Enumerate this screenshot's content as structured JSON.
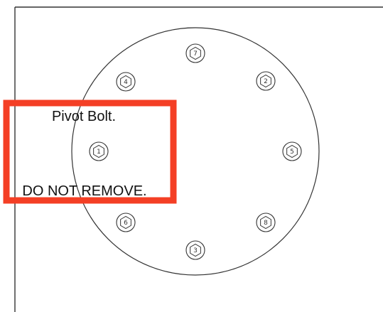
{
  "bolts": [
    {
      "label": "1",
      "shape": "hexagon",
      "pivot": true
    },
    {
      "label": "2",
      "shape": "hexagon"
    },
    {
      "label": "3",
      "shape": "hexagon"
    },
    {
      "label": "4",
      "shape": "hexagon"
    },
    {
      "label": "5",
      "shape": "hexagon"
    },
    {
      "label": "6",
      "shape": "hexagon"
    },
    {
      "label": "7",
      "shape": "hexagon"
    },
    {
      "label": "8",
      "shape": "hexagon"
    }
  ],
  "callout": {
    "line1": "Pivot Bolt.",
    "line2": "DO NOT REMOVE.",
    "border_color": "#f43f25"
  },
  "colors": {
    "line": "#333333",
    "background": "#ffffff"
  }
}
